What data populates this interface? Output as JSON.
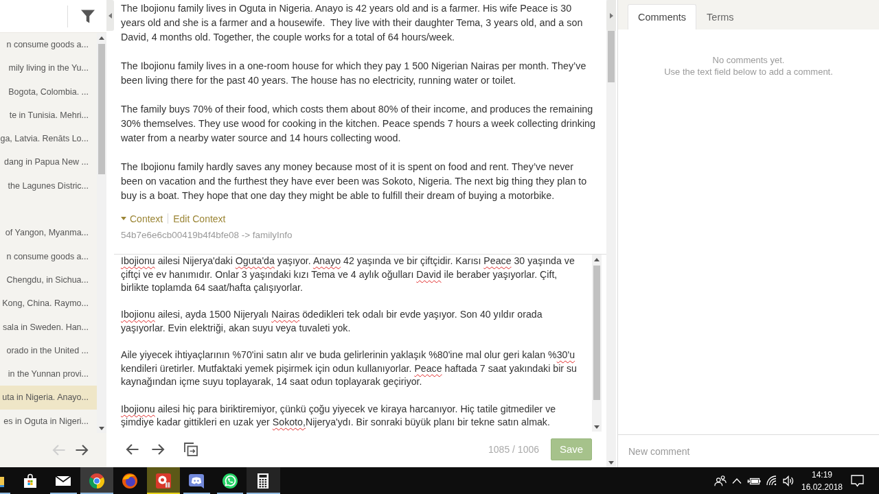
{
  "sidebar": {
    "items": [
      {
        "text": "n consume goods a...",
        "selected": false
      },
      {
        "text": "mily living in the Yu...",
        "selected": false
      },
      {
        "text": "Bogota, Colombia. ...",
        "selected": false
      },
      {
        "text": "te in Tunisia. Mehri...",
        "selected": false
      },
      {
        "text": "ga, Latvia. Renāts Lo...",
        "selected": false
      },
      {
        "text": "dang in Papua New ...",
        "selected": false
      },
      {
        "text": "the Lagunes Distric...",
        "selected": false
      },
      {
        "selected": false
      },
      {
        "text": "of Yangon, Myanma...",
        "selected": false
      },
      {
        "text": "n consume goods a...",
        "selected": false
      },
      {
        "text": "Chengdu, in Sichua...",
        "selected": false
      },
      {
        "text": "Kong, China. Raymo...",
        "selected": false
      },
      {
        "text": "sala in Sweden. Han...",
        "selected": false
      },
      {
        "text": "orado in the United ...",
        "selected": false
      },
      {
        "text": "in the Yunnan provi...",
        "selected": false
      },
      {
        "text": "uta in Nigeria. Anayo...",
        "selected": true
      },
      {
        "text": "es in Oguta in Nigeri...",
        "selected": false
      }
    ],
    "nav": [
      {
        "kind": "back",
        "disabled": true
      },
      {
        "kind": "forward",
        "disabled": false
      }
    ]
  },
  "source": {
    "paragraphs": [
      "The Ibojionu family lives in Oguta in Nigeria. Anayo is 42 years old and is a farmer. His wife Peace is 30 years old and she is a farmer and a housewife.  They live with their daughter Tema, 3 years old, and a son David, 4 months old. Together, the couple works for a total of 64 hours/week.",
      "The Ibojionu family lives in a one-room house for which they pay 1 500 Nigerian Nairas per month. They’ve been living there for the past 40 years. The house has no electricity, running water or toilet.",
      "The family buys 70% of their food, which costs them about 80% of their income, and produces the remaining 30% themselves. They use wood for cooking in the kitchen. Peace spends 7 hours a week collecting drinking water from a nearby water source and 14 hours collecting wood.",
      "The Ibojionu family hardly saves any money because most of it is spent on food and rent. They’ve never been on vacation and the furthest they have ever been was Sokoto, Nigeria. The next big thing they plan to buy is a boat. They hope that one day they might be able to fulfill their dream of buying a motorbike."
    ],
    "context_toggle": {
      "label": "Context",
      "expanded": true
    },
    "edit_context": "Edit Context",
    "key": "54b7e6e6cb00419b4f4bfe08 -> familyInfo"
  },
  "translation": {
    "paragraphs": [
      {
        "segments": [
          {
            "text": "Ibojionu",
            "misspelled": true
          },
          {
            "text": " ailesi Nijerya'daki ",
            "misspelled": false
          },
          {
            "text": "Oguta'da",
            "misspelled": true
          },
          {
            "text": " yaşıyor. ",
            "misspelled": false
          },
          {
            "text": "Anayo",
            "misspelled": true
          },
          {
            "text": " 42 yaşında ve bir çiftçidir. Karısı ",
            "misspelled": false
          },
          {
            "text": "Peace",
            "misspelled": true
          },
          {
            "text": " 30 yaşında ve çiftçi ve ev hanımıdır. Onlar 3 yaşındaki kızı Tema ve 4 aylık oğulları ",
            "misspelled": false
          },
          {
            "text": "David",
            "misspelled": true
          },
          {
            "text": " ile beraber yaşıyorlar. Çift, birlikte toplamda 64 saat/hafta çalışıyorlar.",
            "misspelled": false
          }
        ]
      },
      {
        "segments": [
          {
            "text": "Ibojionu",
            "misspelled": true
          },
          {
            "text": " ailesi, ayda 1500 Nijeryalı ",
            "misspelled": false
          },
          {
            "text": "Nairas",
            "misspelled": true
          },
          {
            "text": " ödedikleri tek odalı bir evde yaşıyor. Son 40 yıldır orada yaşıyorlar. Evin elektriği, akan suyu veya tuvaleti yok.",
            "misspelled": false
          }
        ]
      },
      {
        "segments": [
          {
            "text": "Aile yiyecek ihtiyaçlarının %70'ini satın alır ve buda gelirlerinin yaklaşık %80'ine mal olur geri kalan %",
            "misspelled": false
          },
          {
            "text": "30'u",
            "misspelled": true
          },
          {
            "text": " kendileri üretirler. Mutfaktaki yemek pişirmek için odun kullanıyorlar. ",
            "misspelled": false
          },
          {
            "text": "Peace",
            "misspelled": true
          },
          {
            "text": " haftada 7 saat yakındaki bir su kaynağından içme suyu toplayarak, 14 saat odun toplayarak geçiriyor.",
            "misspelled": false
          }
        ]
      },
      {
        "segments": [
          {
            "text": "Ibojionu",
            "misspelled": true
          },
          {
            "text": " ailesi hiç para biriktiremiyor, çünkü çoğu yiyecek ve kiraya harcanıyor. Hiç tatile gitmediler ve şimdiye kadar gittikleri en uzak yer ",
            "misspelled": false
          },
          {
            "text": "Sokoto,",
            "misspelled": true
          },
          {
            "text": "Nijerya'ydı. Bir sonraki büyük planı bir tekne satın almak.",
            "misspelled": false
          }
        ]
      }
    ]
  },
  "toolbar": {
    "nav": [
      {
        "kind": "back",
        "disabled": false
      },
      {
        "kind": "forward",
        "disabled": false
      }
    ],
    "counter": "1085 / 1006",
    "save_button": "Save"
  },
  "panel": {
    "tabs": [
      {
        "label": "Comments",
        "selected": true
      },
      {
        "label": "Terms",
        "selected": false
      }
    ],
    "empty_message": [
      "No comments yet.",
      "Use the text field below to add a comment."
    ],
    "comment_field": {
      "placeholder": "New comment"
    }
  },
  "taskbar": {
    "apps": [
      {
        "kind": "folder",
        "running": true,
        "selected": false,
        "flashing": false,
        "hovered": false
      },
      {
        "kind": "store",
        "running": false,
        "selected": false,
        "flashing": false,
        "hovered": false
      },
      {
        "kind": "mail",
        "running": true,
        "selected": false,
        "flashing": false,
        "hovered": false
      },
      {
        "kind": "ring_browser",
        "running": true,
        "selected": true,
        "flashing": false,
        "hovered": false
      },
      {
        "kind": "globe_browser",
        "running": false,
        "selected": false,
        "flashing": false,
        "hovered": false
      },
      {
        "kind": "media",
        "running": true,
        "selected": false,
        "flashing": true,
        "hovered": false
      },
      {
        "kind": "game_chat",
        "running": true,
        "selected": false,
        "flashing": false,
        "hovered": false
      },
      {
        "kind": "messenger",
        "running": true,
        "selected": false,
        "flashing": false,
        "hovered": false
      },
      {
        "kind": "calculator",
        "running": true,
        "selected": false,
        "flashing": false,
        "hovered": true
      }
    ],
    "clock": {
      "time": "14:19",
      "date": "16.02.2018"
    }
  }
}
